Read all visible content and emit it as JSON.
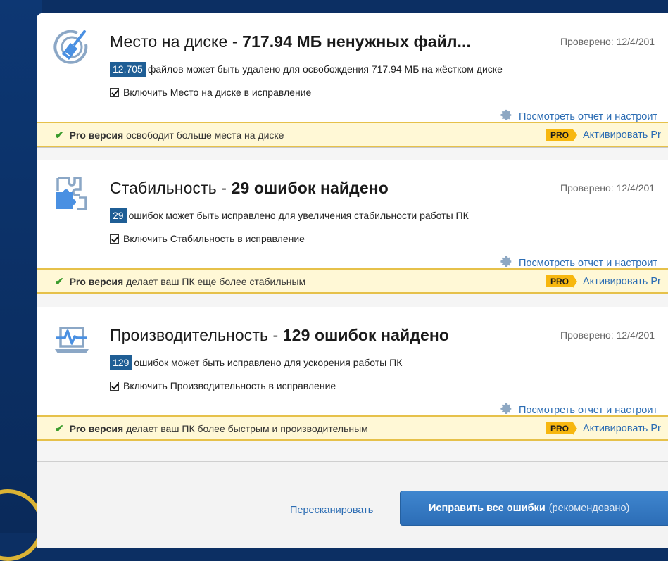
{
  "cards": [
    {
      "title_prefix": "Место на диске - ",
      "title_bold": "717.94 МБ ненужных файл...",
      "checked_label": "Проверено: 12/4/201",
      "count": "12,705",
      "count_text": "файлов может быть удалено для освобождения 717.94 МБ на жёстком диске",
      "include_label": "Включить Место на диске в исправление",
      "report_link": "Посмотреть отчет и настроит",
      "pro_bold": "Pro версия",
      "pro_text": "освободит больше места на диске",
      "pro_tag": "PRO",
      "pro_link": "Активировать Pr",
      "icon": "disk-cleanup-broom-icon"
    },
    {
      "title_prefix": "Стабильность - ",
      "title_bold": "29 ошибок найдено",
      "checked_label": "Проверено: 12/4/201",
      "count": "29",
      "count_text": "ошибок может быть исправлено для увеличения стабильности работы ПК",
      "include_label": "Включить Стабильность в исправление",
      "report_link": "Посмотреть отчет и настроит",
      "pro_bold": "Pro версия",
      "pro_text": "делает ваш ПК еще более стабильным",
      "pro_tag": "PRO",
      "pro_link": "Активировать Pr",
      "icon": "puzzle-stability-icon"
    },
    {
      "title_prefix": "Производительность - ",
      "title_bold": "129 ошибок найдено",
      "checked_label": "Проверено: 12/4/201",
      "count": "129",
      "count_text": "ошибок может быть исправлено для ускорения работы ПК",
      "include_label": "Включить Производительность в исправление",
      "report_link": "Посмотреть отчет и настроит",
      "pro_bold": "Pro версия",
      "pro_text": "делает ваш ПК более быстрым и производительным",
      "pro_tag": "PRO",
      "pro_link": "Активировать Pr",
      "icon": "laptop-performance-icon"
    }
  ],
  "footer": {
    "rescan": "Пересканировать",
    "fix_bold": "Исправить все ошибки",
    "fix_muted": "(рекомендовано)"
  },
  "colors": {
    "accent": "#2b6cb3",
    "badge": "#1f5e95",
    "pro_bar_bg": "#fff8d6",
    "pro_tag": "#f7b70f",
    "check_green": "#3a9b2c",
    "background": "#0c2f63"
  }
}
